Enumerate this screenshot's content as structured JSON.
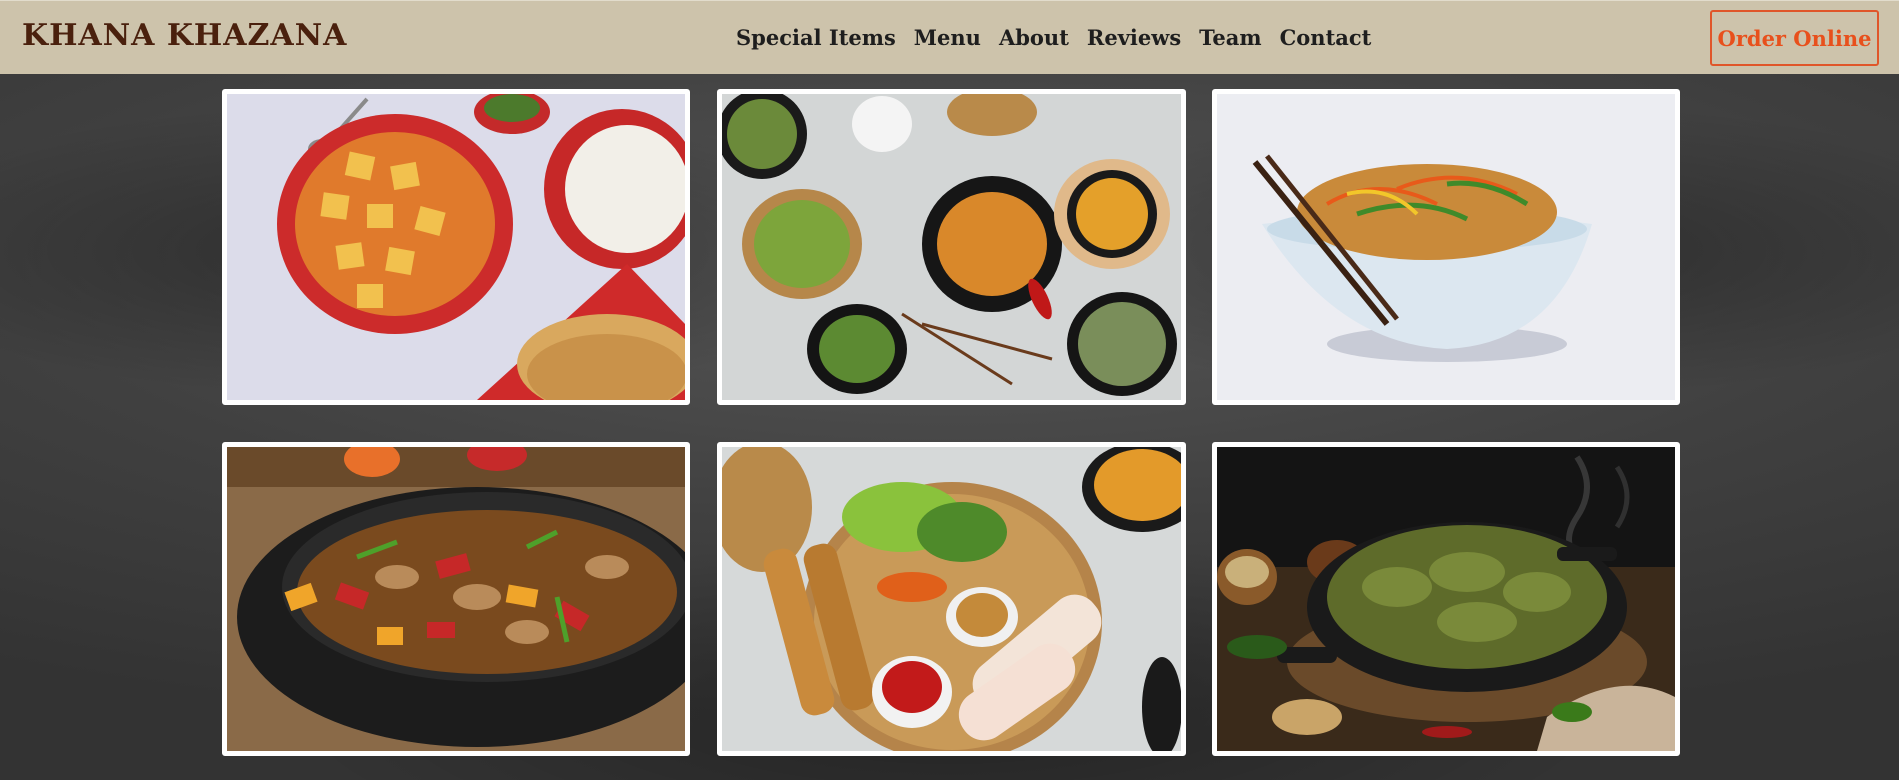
{
  "navbar": {
    "brand": "KHANA KHAZANA",
    "links": [
      "Special Items",
      "Menu",
      "About",
      "Reviews",
      "Team",
      "Contact"
    ],
    "cta": "Order Online"
  },
  "colors": {
    "navbar_bg": "#cdc3ab",
    "brand_text": "#4a200d",
    "nav_text": "#1e1e1e",
    "cta_accent": "#e8501c",
    "page_bg": "#404040",
    "tile_border": "#ffffff"
  },
  "gallery": [
    {
      "name": "paneer-curry-photo",
      "depicts": "paneer curry with rice and paratha"
    },
    {
      "name": "asian-platter-photo",
      "depicts": "asian food platter spread"
    },
    {
      "name": "noodles-bowl-photo",
      "depicts": "noodle bowl with chopsticks"
    },
    {
      "name": "chicken-stir-fry-photo",
      "depicts": "chicken stir fry in wok"
    },
    {
      "name": "spring-rolls-basket-photo",
      "depicts": "spring rolls basket with dips"
    },
    {
      "name": "green-chicken-curry-photo",
      "depicts": "green chicken curry in skillet"
    }
  ]
}
